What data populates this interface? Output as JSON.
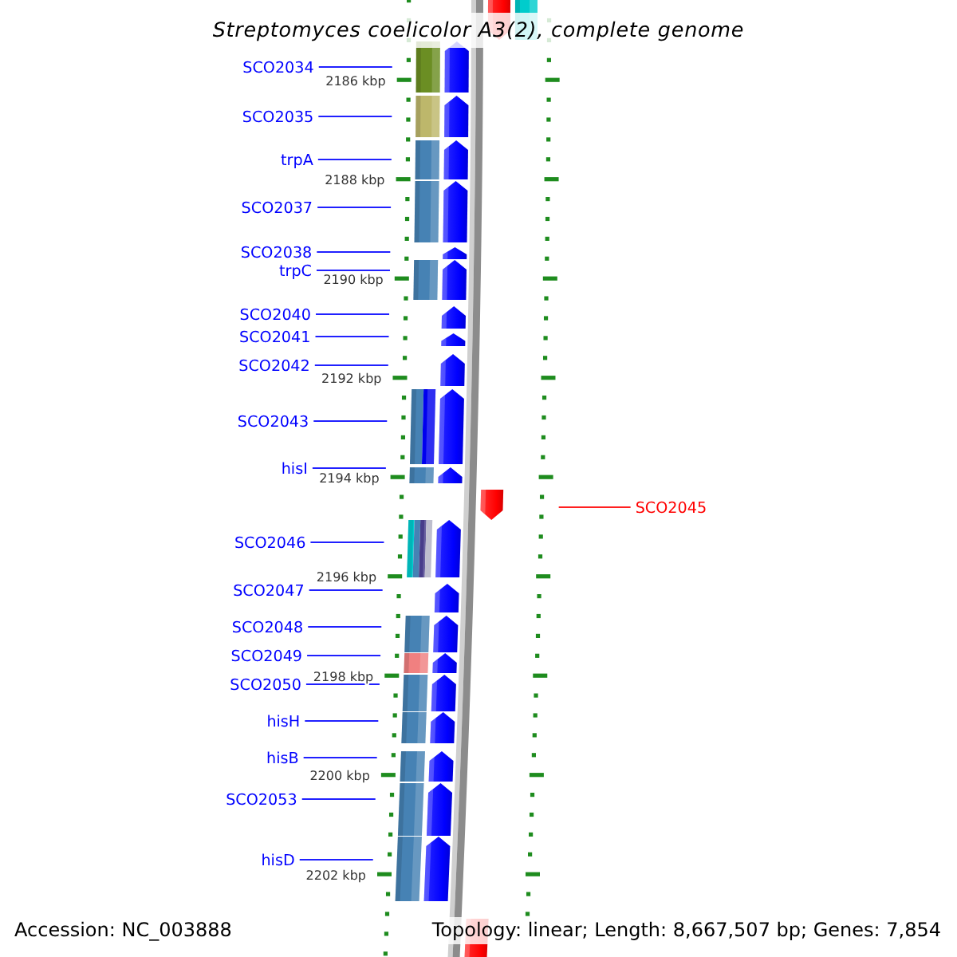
{
  "title": "Streptomyces coelicolor A3(2), complete genome",
  "map": {
    "scale_labels": [
      "2186 kbp",
      "2188 kbp",
      "2190 kbp",
      "2192 kbp",
      "2194 kbp",
      "2196 kbp",
      "2198 kbp",
      "2200 kbp",
      "2202 kbp"
    ],
    "partial_genes": [
      {
        "kind": "forward",
        "categories": [
          {
            "color": "#00cccc"
          }
        ]
      },
      {
        "kind": "forward"
      }
    ],
    "genes": [
      {
        "name": "SCO2034",
        "kind": "reverse",
        "categories": [
          {
            "color": "#6b8e23"
          }
        ]
      },
      {
        "name": "SCO2035",
        "kind": "reverse",
        "categories": [
          {
            "color": "#bdb76b"
          }
        ]
      },
      {
        "name": "trpA",
        "kind": "reverse",
        "categories": [
          {
            "color": "#4682b4"
          }
        ]
      },
      {
        "name": "SCO2037",
        "kind": "reverse",
        "categories": [
          {
            "color": "#4682b4"
          }
        ]
      },
      {
        "name": "SCO2038",
        "kind": "reverse"
      },
      {
        "name": "trpC",
        "kind": "reverse",
        "categories": [
          {
            "color": "#4682b4"
          }
        ]
      },
      {
        "name": "SCO2040",
        "kind": "reverse"
      },
      {
        "name": "SCO2041",
        "kind": "reverse"
      },
      {
        "name": "SCO2042",
        "kind": "reverse"
      },
      {
        "name": "SCO2043",
        "kind": "reverse",
        "categories": [
          {
            "color": "#4682b4"
          },
          {
            "color": "#0000ee"
          }
        ]
      },
      {
        "name": "hisI",
        "kind": "reverse",
        "categories": [
          {
            "color": "#4682b4"
          }
        ]
      },
      {
        "name": "SCO2045",
        "kind": "forward"
      },
      {
        "name": "SCO2046",
        "kind": "reverse",
        "categories": [
          {
            "color": "#00ced1"
          },
          {
            "color": "#4682b4"
          },
          {
            "color": "#483d8b"
          },
          {
            "color": "#b0b0c4"
          }
        ]
      },
      {
        "name": "SCO2047",
        "kind": "reverse"
      },
      {
        "name": "SCO2048",
        "kind": "reverse",
        "categories": [
          {
            "color": "#4682b4"
          }
        ]
      },
      {
        "name": "SCO2049",
        "kind": "reverse",
        "categories": [
          {
            "color": "#f08080"
          }
        ]
      },
      {
        "name": "SCO2050",
        "kind": "reverse",
        "categories": [
          {
            "color": "#4682b4"
          }
        ]
      },
      {
        "name": "hisH",
        "kind": "reverse",
        "categories": [
          {
            "color": "#4682b4"
          }
        ]
      },
      {
        "name": "hisB",
        "kind": "reverse",
        "categories": [
          {
            "color": "#4682b4"
          }
        ]
      },
      {
        "name": "SCO2053",
        "kind": "reverse",
        "categories": [
          {
            "color": "#4682b4"
          }
        ]
      },
      {
        "name": "hisD",
        "kind": "reverse",
        "categories": [
          {
            "color": "#4682b4"
          }
        ]
      }
    ]
  },
  "footer": {
    "accession": "Accession: NC_003888",
    "summary": "Topology: linear; Length: 8,667,507 bp; Genes: 7,854"
  }
}
